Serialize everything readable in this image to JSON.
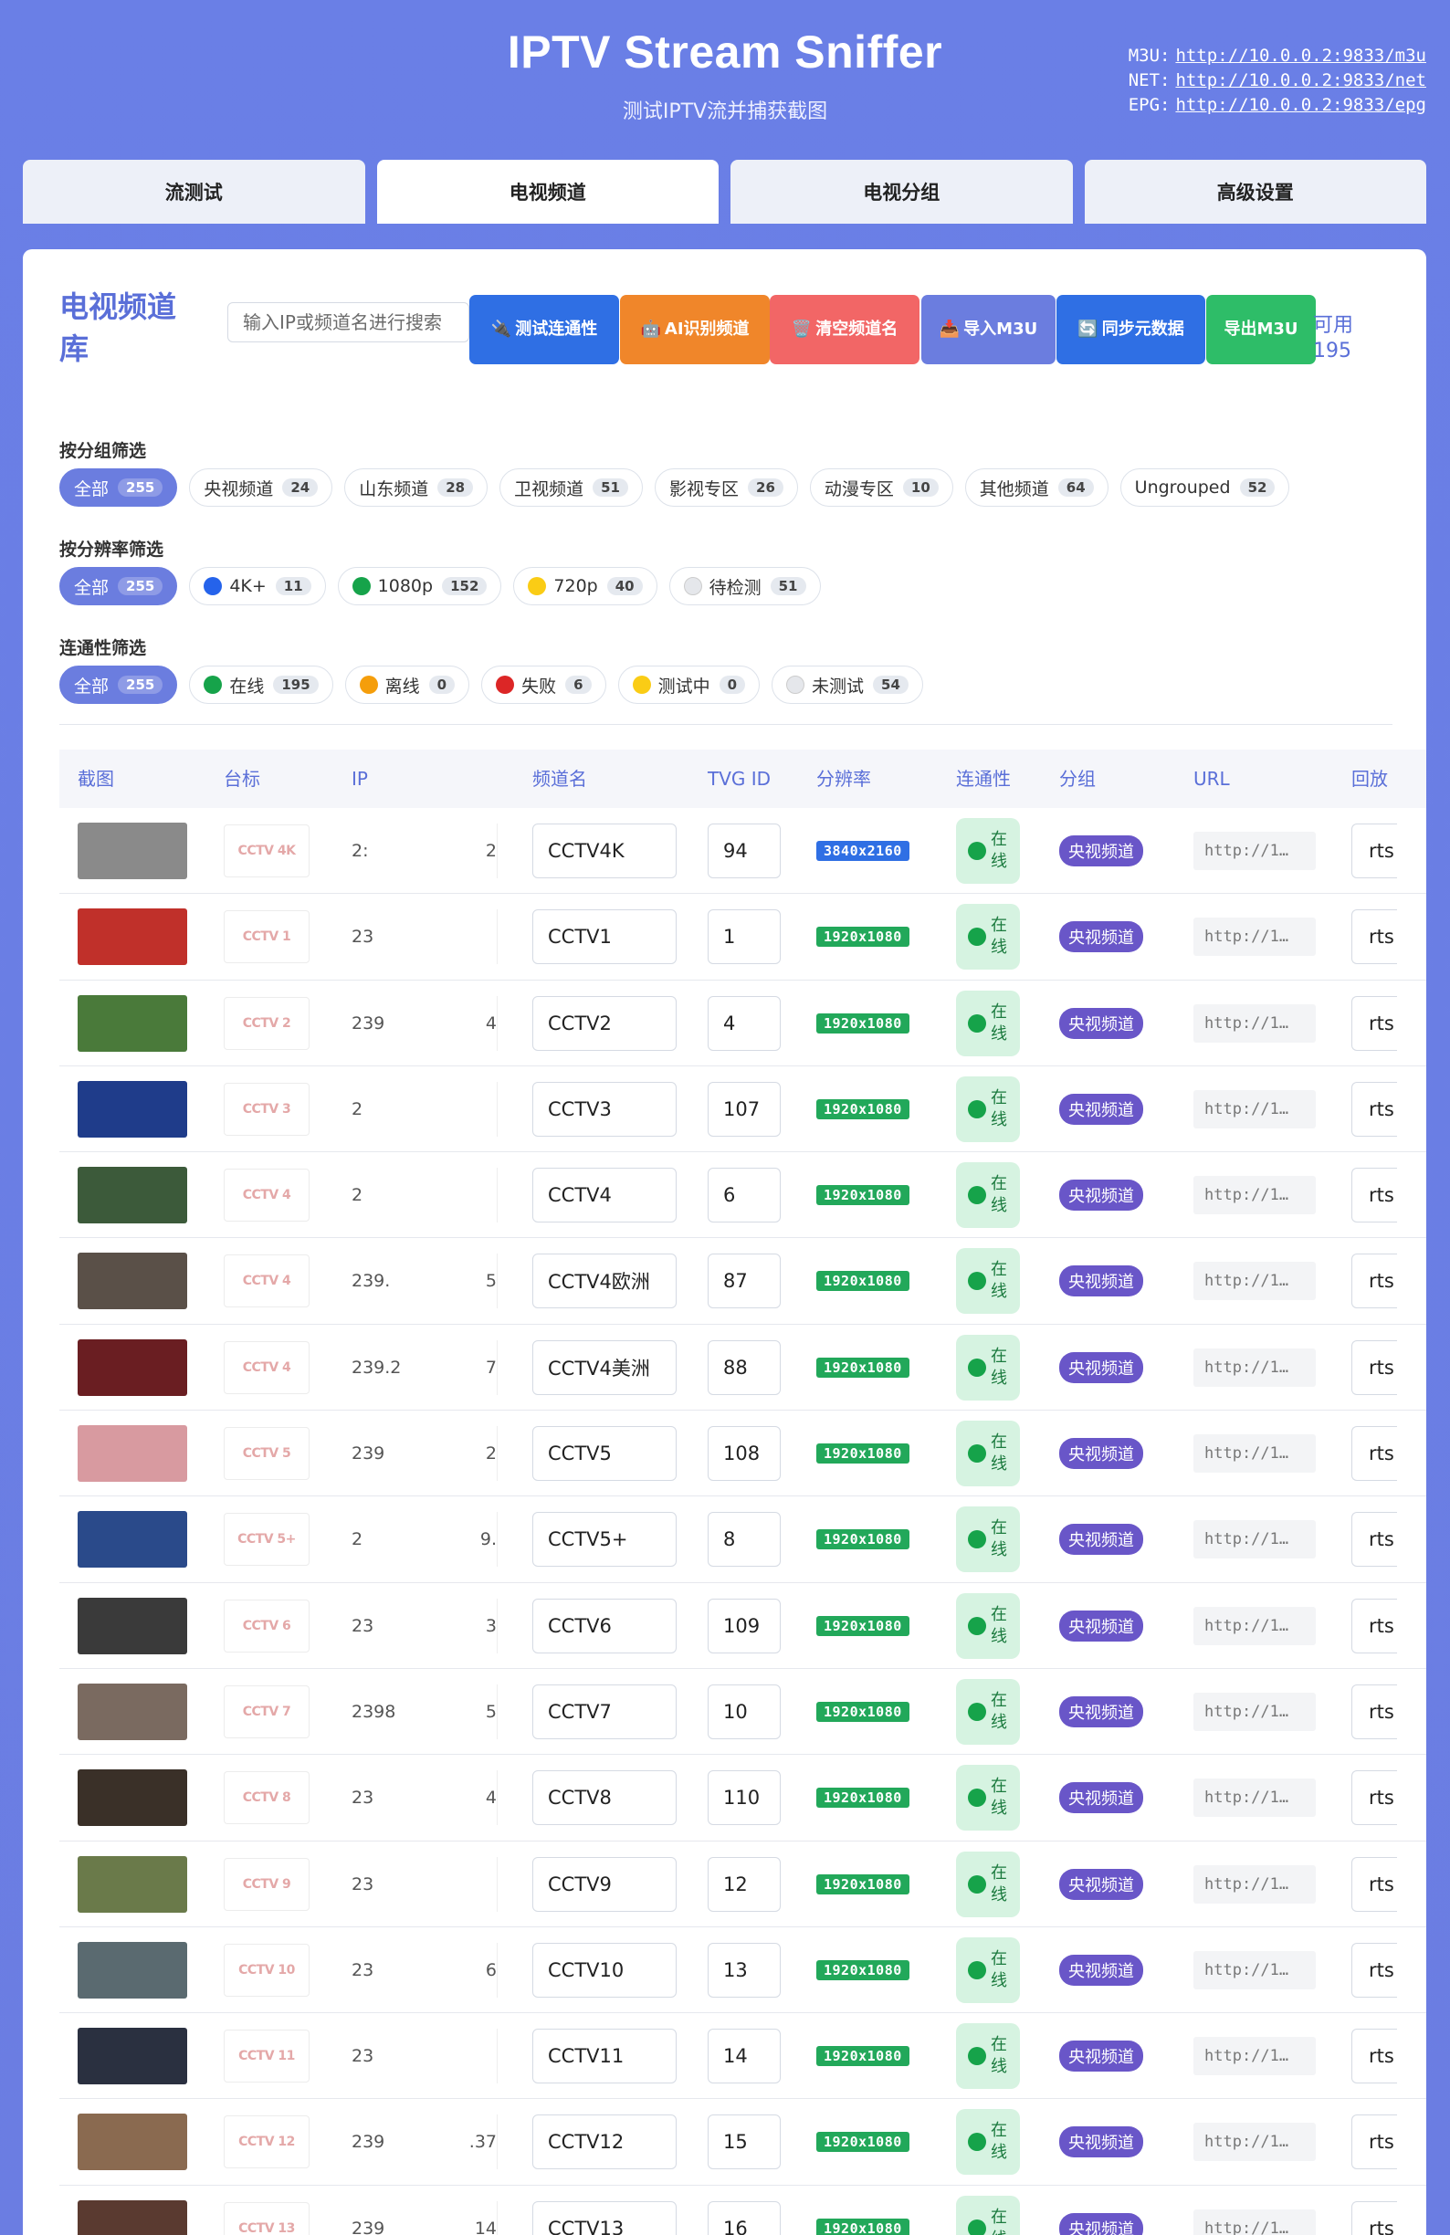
{
  "header": {
    "title": "IPTV Stream Sniffer",
    "subtitle": "测试IPTV流并捕获截图",
    "endpoints": [
      {
        "label": "M3U:",
        "url": "http://10.0.0.2:9833/m3u"
      },
      {
        "label": "NET:",
        "url": "http://10.0.0.2:9833/net"
      },
      {
        "label": "EPG:",
        "url": "http://10.0.0.2:9833/epg"
      }
    ]
  },
  "tabs": [
    "流测试",
    "电视频道",
    "电视分组",
    "高级设置"
  ],
  "active_tab": "电视频道",
  "toolbar": {
    "title": "电视频道库",
    "search_placeholder": "输入IP或频道名进行搜索",
    "buttons": [
      {
        "icon": "🔌",
        "label": "测试连通性",
        "color": "#2f6fe4"
      },
      {
        "icon": "🤖",
        "label": "AI识别频道",
        "color": "#f0862a"
      },
      {
        "icon": "🗑️",
        "label": "清空频道名",
        "color": "#f26666"
      },
      {
        "icon": "📥",
        "label": "导入M3U",
        "color": "#6b7ddf"
      },
      {
        "icon": "🔄",
        "label": "同步元数据",
        "color": "#2f6fe4"
      },
      {
        "icon": "",
        "label": "导出M3U",
        "color": "#2ebd68"
      }
    ],
    "available_label": "可用",
    "available_count": "195"
  },
  "filters": {
    "group": {
      "label": "按分组筛选",
      "chips": [
        {
          "label": "全部",
          "count": "255",
          "active": true
        },
        {
          "label": "央视频道",
          "count": "24"
        },
        {
          "label": "山东频道",
          "count": "28"
        },
        {
          "label": "卫视频道",
          "count": "51"
        },
        {
          "label": "影视专区",
          "count": "26"
        },
        {
          "label": "动漫专区",
          "count": "10"
        },
        {
          "label": "其他频道",
          "count": "64"
        },
        {
          "label": "Ungrouped",
          "count": "52"
        }
      ]
    },
    "resolution": {
      "label": "按分辨率筛选",
      "chips": [
        {
          "label": "全部",
          "count": "255",
          "active": true
        },
        {
          "label": "4K+",
          "count": "11",
          "dot": "#2563eb"
        },
        {
          "label": "1080p",
          "count": "152",
          "dot": "#16a34a"
        },
        {
          "label": "720p",
          "count": "40",
          "dot": "#facc15"
        },
        {
          "label": "待检测",
          "count": "51",
          "dot": "#e5e7eb"
        }
      ]
    },
    "connectivity": {
      "label": "连通性筛选",
      "chips": [
        {
          "label": "全部",
          "count": "255",
          "active": true
        },
        {
          "label": "在线",
          "count": "195",
          "dot": "#16a34a"
        },
        {
          "label": "离线",
          "count": "0",
          "dot": "#f59e0b"
        },
        {
          "label": "失败",
          "count": "6",
          "dot": "#dc2626"
        },
        {
          "label": "测试中",
          "count": "0",
          "dot": "#facc15"
        },
        {
          "label": "未测试",
          "count": "54",
          "dot": "#e5e7eb"
        }
      ]
    }
  },
  "table": {
    "columns": [
      "截图",
      "台标",
      "IP",
      "频道名",
      "TVG ID",
      "分辨率",
      "连通性",
      "分组",
      "URL",
      "回放"
    ],
    "rows": [
      {
        "thumb": "#8a8a8a",
        "logo": "CCTV 4K",
        "ip": "2:",
        "ip_end": "2",
        "name": "CCTV4K",
        "tvg": "94",
        "res": "3840x2160",
        "conn": "在线",
        "group": "央视频道",
        "url": "http://1…",
        "replay": "rts"
      },
      {
        "thumb": "#c0302a",
        "logo": "CCTV 1",
        "ip": "23",
        "ip_end": "",
        "name": "CCTV1",
        "tvg": "1",
        "res": "1920x1080",
        "conn": "在线",
        "group": "央视频道",
        "url": "http://1…",
        "replay": "rts"
      },
      {
        "thumb": "#4a7a3a",
        "logo": "CCTV 2",
        "ip": "239",
        "ip_end": "4",
        "name": "CCTV2",
        "tvg": "4",
        "res": "1920x1080",
        "conn": "在线",
        "group": "央视频道",
        "url": "http://1…",
        "replay": "rts"
      },
      {
        "thumb": "#1f3c8a",
        "logo": "CCTV 3",
        "ip": "2",
        "ip_end": "",
        "name": "CCTV3",
        "tvg": "107",
        "res": "1920x1080",
        "conn": "在线",
        "group": "央视频道",
        "url": "http://1…",
        "replay": "rts"
      },
      {
        "thumb": "#3c5a3a",
        "logo": "CCTV 4",
        "ip": "2",
        "ip_end": "",
        "name": "CCTV4",
        "tvg": "6",
        "res": "1920x1080",
        "conn": "在线",
        "group": "央视频道",
        "url": "http://1…",
        "replay": "rts"
      },
      {
        "thumb": "#5a5048",
        "logo": "CCTV 4",
        "ip": "239.",
        "ip_end": "5",
        "name": "CCTV4欧洲",
        "tvg": "87",
        "res": "1920x1080",
        "conn": "在线",
        "group": "央视频道",
        "url": "http://1…",
        "replay": "rts"
      },
      {
        "thumb": "#6a1e22",
        "logo": "CCTV 4",
        "ip": "239.2",
        "ip_end": "7",
        "name": "CCTV4美洲",
        "tvg": "88",
        "res": "1920x1080",
        "conn": "在线",
        "group": "央视频道",
        "url": "http://1…",
        "replay": "rts"
      },
      {
        "thumb": "#d89aa0",
        "logo": "CCTV 5",
        "ip": "239",
        "ip_end": "2",
        "name": "CCTV5",
        "tvg": "108",
        "res": "1920x1080",
        "conn": "在线",
        "group": "央视频道",
        "url": "http://1…",
        "replay": "rts"
      },
      {
        "thumb": "#2a4a8a",
        "logo": "CCTV 5+",
        "ip": "2",
        "ip_end": "9.",
        "name": "CCTV5+",
        "tvg": "8",
        "res": "1920x1080",
        "conn": "在线",
        "group": "央视频道",
        "url": "http://1…",
        "replay": "rts"
      },
      {
        "thumb": "#3a3a3a",
        "logo": "CCTV 6",
        "ip": "23",
        "ip_end": "3",
        "name": "CCTV6",
        "tvg": "109",
        "res": "1920x1080",
        "conn": "在线",
        "group": "央视频道",
        "url": "http://1…",
        "replay": "rts"
      },
      {
        "thumb": "#7a6a60",
        "logo": "CCTV 7",
        "ip": "2398",
        "ip_end": "5",
        "name": "CCTV7",
        "tvg": "10",
        "res": "1920x1080",
        "conn": "在线",
        "group": "央视频道",
        "url": "http://1…",
        "replay": "rts"
      },
      {
        "thumb": "#3a3028",
        "logo": "CCTV 8",
        "ip": "23",
        "ip_end": "4",
        "name": "CCTV8",
        "tvg": "110",
        "res": "1920x1080",
        "conn": "在线",
        "group": "央视频道",
        "url": "http://1…",
        "replay": "rts"
      },
      {
        "thumb": "#6a7a4a",
        "logo": "CCTV 9",
        "ip": "23",
        "ip_end": "",
        "name": "CCTV9",
        "tvg": "12",
        "res": "1920x1080",
        "conn": "在线",
        "group": "央视频道",
        "url": "http://1…",
        "replay": "rts"
      },
      {
        "thumb": "#5a6a70",
        "logo": "CCTV 10",
        "ip": "23",
        "ip_end": "6",
        "name": "CCTV10",
        "tvg": "13",
        "res": "1920x1080",
        "conn": "在线",
        "group": "央视频道",
        "url": "http://1…",
        "replay": "rts"
      },
      {
        "thumb": "#2a3040",
        "logo": "CCTV 11",
        "ip": "23",
        "ip_end": "",
        "name": "CCTV11",
        "tvg": "14",
        "res": "1920x1080",
        "conn": "在线",
        "group": "央视频道",
        "url": "http://1…",
        "replay": "rts"
      },
      {
        "thumb": "#8a6a50",
        "logo": "CCTV 12",
        "ip": "239",
        "ip_end": ".37",
        "name": "CCTV12",
        "tvg": "15",
        "res": "1920x1080",
        "conn": "在线",
        "group": "央视频道",
        "url": "http://1…",
        "replay": "rts"
      },
      {
        "thumb": "#5a3a30",
        "logo": "CCTV 13",
        "ip": "239",
        "ip_end": "14",
        "name": "CCTV13",
        "tvg": "16",
        "res": "1920x1080",
        "conn": "在线",
        "group": "央视频道",
        "url": "http://1…",
        "replay": "rts"
      }
    ]
  }
}
